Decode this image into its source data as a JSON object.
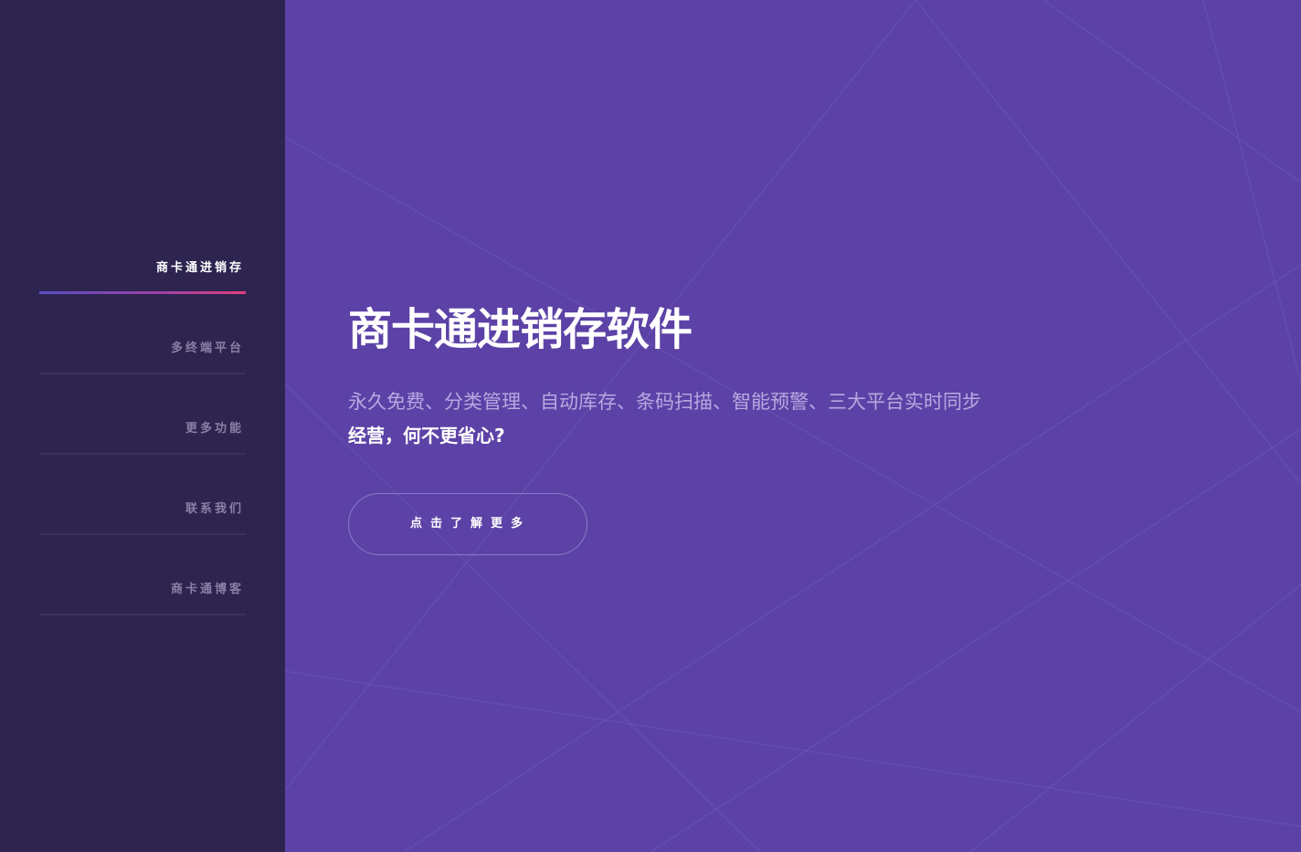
{
  "sidebar": {
    "items": [
      {
        "label": "商卡通进销存"
      },
      {
        "label": "多终端平台"
      },
      {
        "label": "更多功能"
      },
      {
        "label": "联系我们"
      },
      {
        "label": "商卡通博客"
      }
    ]
  },
  "hero": {
    "title": "商卡通进销存软件",
    "description": "永久免费、分类管理、自动库存、条码扫描、智能预警、三大平台实时同步",
    "tagline": "经营，何不更省心?",
    "cta_label": "点击了解更多"
  },
  "colors": {
    "sidebar_bg": "#2e2450",
    "hero_bg": "#5c42a6",
    "accent_gradient_start": "#5a4fc4",
    "accent_gradient_end": "#e0407f",
    "muted_text": "#8a80a6",
    "desc_text": "#b7a8e0"
  }
}
